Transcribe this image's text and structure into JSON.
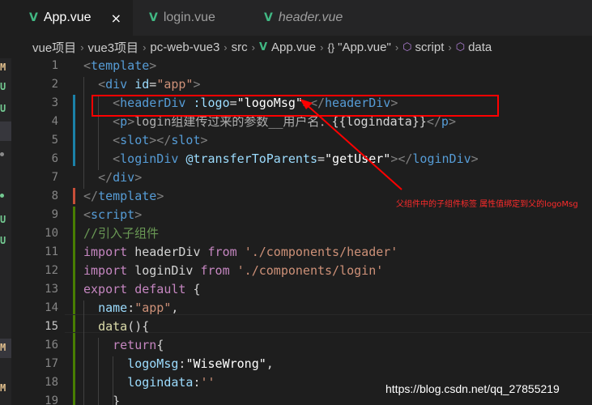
{
  "tabs": [
    {
      "label": "App.vue",
      "icon": "vue-file-icon",
      "active": true,
      "close": "×"
    },
    {
      "label": "login.vue",
      "icon": "vue-file-icon",
      "active": false
    },
    {
      "label": "header.vue",
      "icon": "vue-file-icon",
      "active": false,
      "italic": true
    }
  ],
  "breadcrumb": {
    "separator": "›",
    "items": [
      "vue项目",
      "vue3项目",
      "pc-web-vue3",
      "src",
      "App.vue",
      "\"App.vue\"",
      "script",
      "data"
    ],
    "curly_glyph": "{}",
    "cube_glyph": "⬡"
  },
  "explorer": {
    "status_letters": [
      {
        "text": "M",
        "color": "#e2c08d"
      },
      {
        "text": "U",
        "color": "#73c991"
      },
      {
        "text": "U",
        "color": "#73c991"
      },
      {
        "text": "U",
        "color": "#73c991"
      },
      {
        "text": "U",
        "color": "#73c991"
      },
      {
        "text": "M",
        "color": "#e2c08d"
      },
      {
        "text": "M",
        "color": "#e2c08d"
      }
    ]
  },
  "line_numbers": [
    "1",
    "2",
    "3",
    "4",
    "5",
    "6",
    "7",
    "8",
    "9",
    "10",
    "11",
    "12",
    "13",
    "14",
    "15",
    "16",
    "17",
    "18",
    "19"
  ],
  "current_line": "15",
  "code": {
    "l1_tag": "template",
    "l2_tag": "div",
    "l2_attr": "id",
    "l2_val": "\"app\"",
    "l3_tag": "headerDiv",
    "l3_attr": ":logo",
    "l3_val": "\"logoMsg\"",
    "l4_tag": "p",
    "l4_text": "login组建传过来的参数__用户名：",
    "l4_open": "{{",
    "l4_expr": "logindata",
    "l4_close": "}}",
    "l5_tag": "slot",
    "l6_tag": "loginDiv",
    "l6_attr": "@transferToParents",
    "l6_val": "\"getUser\"",
    "l7_tag": "div",
    "l8_tag": "template",
    "l9_tag": "script",
    "l10_comment": "//引入子组件",
    "l11_kw": "import",
    "l11_id": "headerDiv",
    "l11_from": "from",
    "l11_str": "'./components/header'",
    "l12_kw": "import",
    "l12_id": "loginDiv",
    "l12_from": "from",
    "l12_str": "'./components/login'",
    "l13_kw1": "export",
    "l13_kw2": "default",
    "l13_brace": "{",
    "l14_key": "name",
    "l14_val": "\"app\"",
    "l15_fn": "data",
    "l15_paren": "()",
    "l15_brace": "{",
    "l16_kw": "return",
    "l16_brace": "{",
    "l17_key": "logoMsg",
    "l17_val": "\"WiseWrong\"",
    "l18_key": "logindata",
    "l18_val": "''",
    "l19_brace": "}"
  },
  "annotation": {
    "text": "父组件中的子组件标签 属性值绑定到父的logoMsg",
    "color": "#ff0000"
  },
  "watermark": "https://blog.csdn.net/qq_27855219",
  "colors": {
    "editor_bg": "#1e1e1e",
    "tag": "#569cd6",
    "attr": "#9cdcfe",
    "string": "#ce9178",
    "keyword_control": "#c586c0",
    "comment": "#6a9955",
    "vue_green": "#41b883"
  }
}
